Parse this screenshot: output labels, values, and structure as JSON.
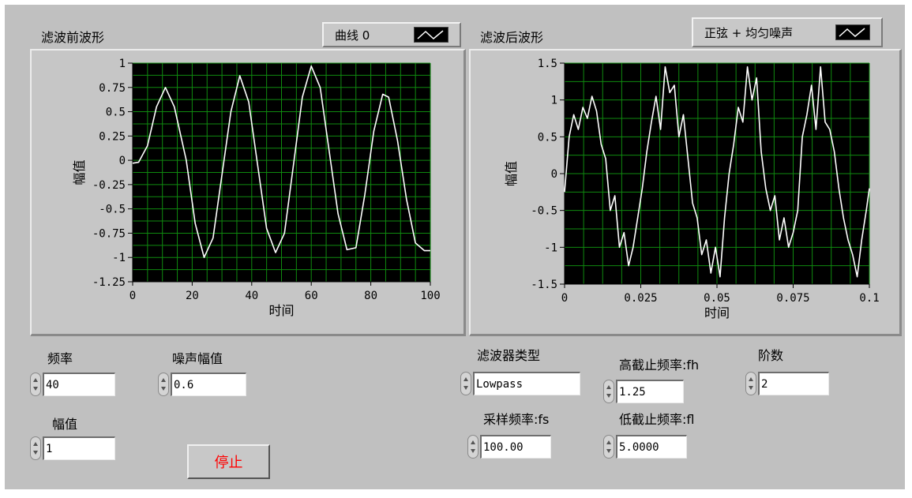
{
  "graph_before": {
    "title": "滤波前波形",
    "legend_label": "曲线 0",
    "ylabel": "幅值",
    "xlabel": "时间",
    "x_ticks": [
      "0",
      "20",
      "40",
      "60",
      "80",
      "100"
    ],
    "y_ticks": [
      "1",
      "0.75",
      "0.5",
      "0.25",
      "0",
      "-0.25",
      "-0.5",
      "-0.75",
      "-1",
      "-1.25"
    ]
  },
  "graph_after": {
    "title": "滤波后波形",
    "legend_label": "正弦 + 均匀噪声",
    "ylabel": "幅值",
    "xlabel": "时间",
    "x_ticks": [
      "0",
      "0.025",
      "0.05",
      "0.075",
      "0.1"
    ],
    "y_ticks": [
      "1.5",
      "1",
      "0.5",
      "0",
      "-0.5",
      "-1",
      "-1.5"
    ]
  },
  "controls": {
    "frequency": {
      "label": "频率",
      "value": "40"
    },
    "noise_amplitude": {
      "label": "噪声幅值",
      "value": "0.6"
    },
    "amplitude": {
      "label": "幅值",
      "value": "1"
    },
    "stop_label": "停止",
    "filter_type": {
      "label": "滤波器类型",
      "value": "Lowpass"
    },
    "high_cutoff": {
      "label": "高截止频率:fh",
      "value": "1.25"
    },
    "order": {
      "label": "阶数",
      "value": "2"
    },
    "sample_rate": {
      "label": "采样频率:fs",
      "value": "100.00"
    },
    "low_cutoff": {
      "label": "低截止频率:fl",
      "value": "5.0000"
    }
  },
  "colors": {
    "panel": "#c0c0c0",
    "plot_bg": "#000000",
    "grid": "#0f8a0f",
    "trace": "#ffffff",
    "stop_text": "#ff0000"
  },
  "chart_data": [
    {
      "type": "line",
      "title": "滤波前波形",
      "xlabel": "时间",
      "ylabel": "幅值",
      "xlim": [
        0,
        100
      ],
      "ylim": [
        -1.25,
        1
      ],
      "grid": true,
      "legend_position": "top-right",
      "series": [
        {
          "name": "曲线 0",
          "x": [
            0,
            2,
            5,
            8,
            11,
            14,
            18,
            21,
            24,
            27,
            30,
            33,
            36,
            39,
            42,
            45,
            48,
            51,
            54,
            57,
            60,
            63,
            66,
            69,
            72,
            75,
            78,
            81,
            84,
            86,
            89,
            92,
            95,
            98,
            100
          ],
          "values": [
            -0.03,
            -0.02,
            0.15,
            0.55,
            0.75,
            0.55,
            0.0,
            -0.65,
            -1.0,
            -0.8,
            -0.15,
            0.5,
            0.87,
            0.6,
            -0.05,
            -0.7,
            -0.95,
            -0.75,
            -0.05,
            0.65,
            0.97,
            0.75,
            0.1,
            -0.55,
            -0.92,
            -0.9,
            -0.35,
            0.3,
            0.68,
            0.65,
            0.2,
            -0.4,
            -0.85,
            -0.93,
            -0.93
          ]
        }
      ]
    },
    {
      "type": "line",
      "title": "滤波后波形",
      "xlabel": "时间",
      "ylabel": "幅值",
      "xlim": [
        0,
        0.1
      ],
      "ylim": [
        -1.5,
        1.5
      ],
      "grid": true,
      "legend_position": "top-right",
      "series": [
        {
          "name": "正弦 + 均匀噪声",
          "x": [
            0,
            0.0015,
            0.003,
            0.0045,
            0.006,
            0.0075,
            0.009,
            0.0105,
            0.012,
            0.0135,
            0.015,
            0.0165,
            0.018,
            0.0195,
            0.021,
            0.0225,
            0.024,
            0.0255,
            0.027,
            0.0285,
            0.03,
            0.0315,
            0.033,
            0.0345,
            0.036,
            0.0375,
            0.039,
            0.0405,
            0.042,
            0.0435,
            0.045,
            0.0465,
            0.048,
            0.0495,
            0.051,
            0.0525,
            0.054,
            0.0555,
            0.057,
            0.0585,
            0.06,
            0.0615,
            0.063,
            0.0645,
            0.066,
            0.0675,
            0.069,
            0.0705,
            0.072,
            0.0735,
            0.075,
            0.0765,
            0.078,
            0.0795,
            0.081,
            0.0825,
            0.084,
            0.0855,
            0.087,
            0.0885,
            0.09,
            0.0915,
            0.093,
            0.0945,
            0.096,
            0.0975,
            0.099,
            0.1
          ],
          "values": [
            -0.25,
            0.5,
            0.8,
            0.6,
            0.9,
            0.75,
            1.05,
            0.85,
            0.4,
            0.2,
            -0.5,
            -0.3,
            -1.0,
            -0.8,
            -1.25,
            -1.0,
            -0.6,
            -0.2,
            0.3,
            0.7,
            1.05,
            0.6,
            1.45,
            1.1,
            1.2,
            0.5,
            0.8,
            0.2,
            -0.4,
            -0.6,
            -1.1,
            -0.9,
            -1.35,
            -1.0,
            -1.4,
            -0.6,
            0.0,
            0.4,
            0.9,
            0.7,
            1.45,
            1.0,
            1.3,
            0.3,
            -0.2,
            -0.5,
            -0.3,
            -0.9,
            -0.6,
            -1.0,
            -0.8,
            -0.5,
            0.5,
            0.8,
            1.2,
            0.6,
            1.45,
            0.7,
            0.6,
            0.3,
            -0.2,
            -0.6,
            -0.9,
            -1.1,
            -1.4,
            -0.9,
            -0.5,
            -0.2
          ]
        }
      ]
    }
  ]
}
